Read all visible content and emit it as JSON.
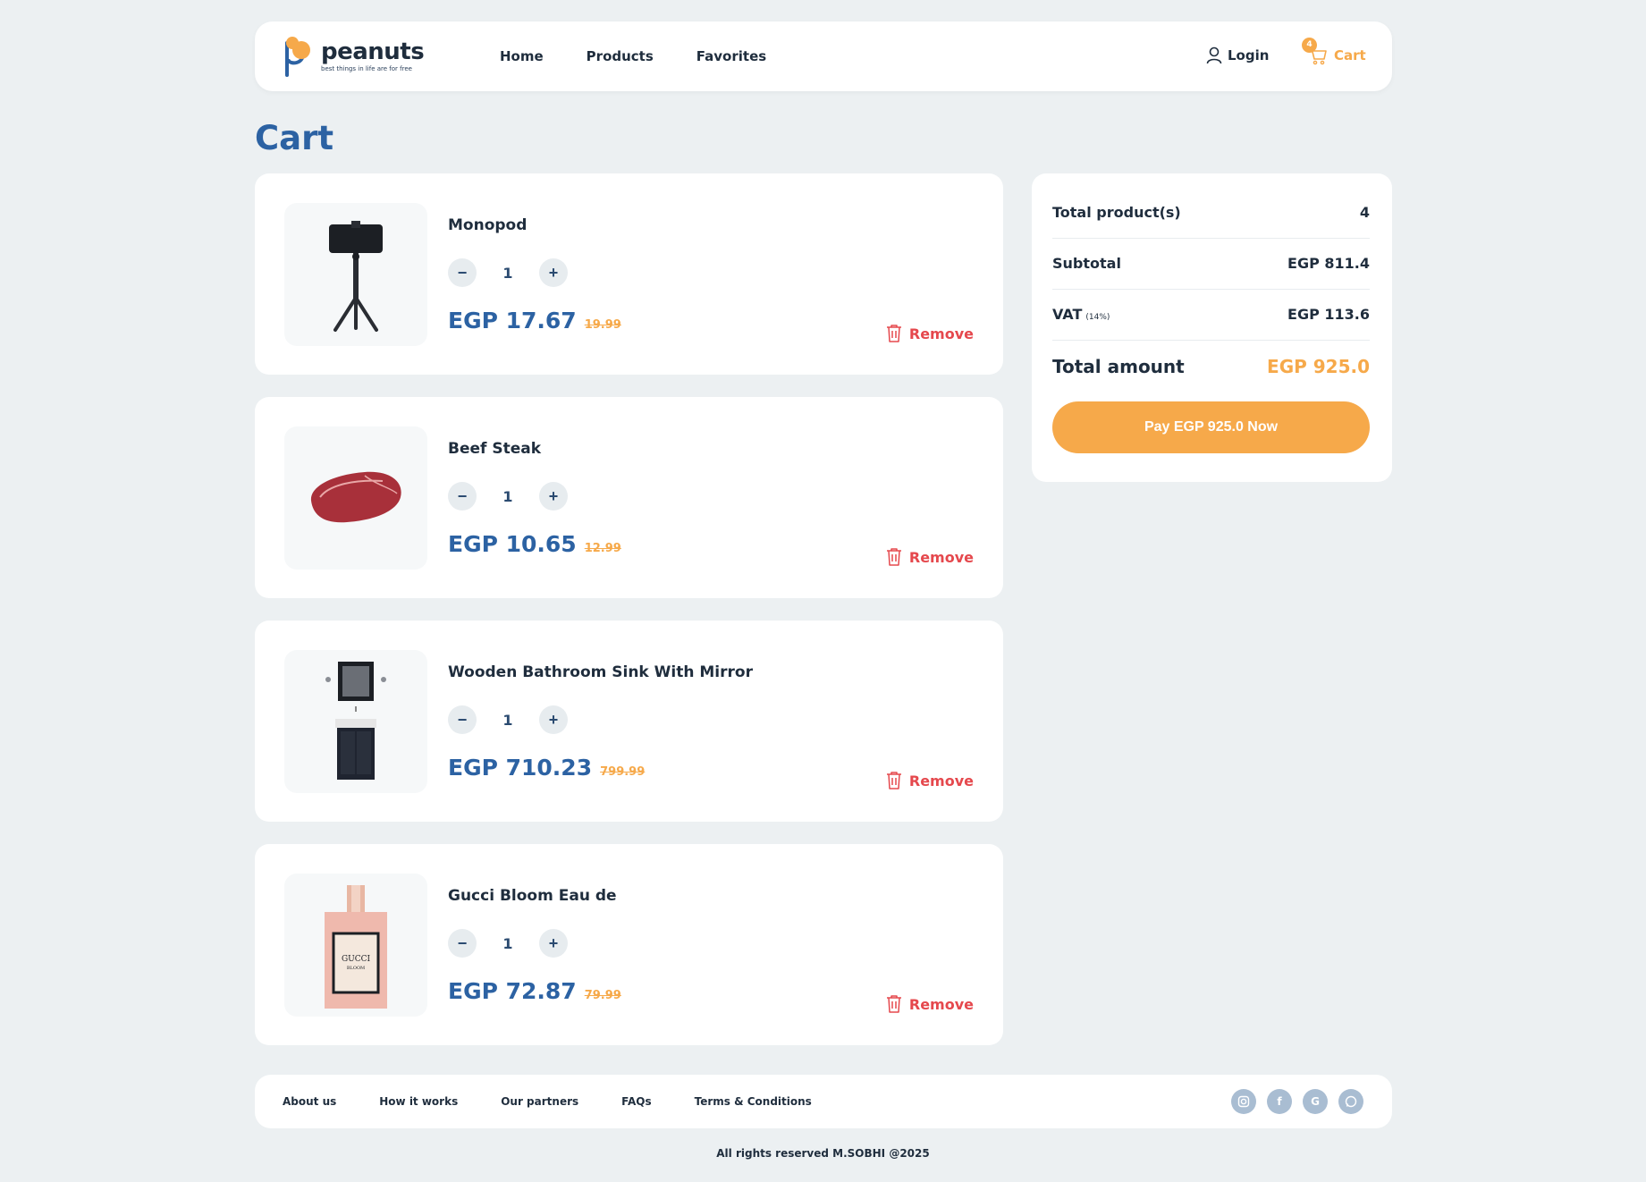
{
  "brand": {
    "name": "peanuts",
    "tagline": "best things in life are for free"
  },
  "nav": {
    "home": "Home",
    "products": "Products",
    "favorites": "Favorites"
  },
  "header": {
    "login": "Login",
    "cart": "Cart",
    "cart_count": "4"
  },
  "page_title": "Cart",
  "items": [
    {
      "name": "Monopod",
      "qty": "1",
      "price": "EGP 17.67",
      "old_price": "19.99",
      "remove": "Remove",
      "image": "monopod-image"
    },
    {
      "name": "Beef Steak",
      "qty": "1",
      "price": "EGP 10.65",
      "old_price": "12.99",
      "remove": "Remove",
      "image": "beef-steak-image"
    },
    {
      "name": "Wooden Bathroom Sink With Mirror",
      "qty": "1",
      "price": "EGP 710.23",
      "old_price": "799.99",
      "remove": "Remove",
      "image": "bathroom-sink-image"
    },
    {
      "name": "Gucci Bloom Eau de",
      "qty": "1",
      "price": "EGP 72.87",
      "old_price": "79.99",
      "remove": "Remove",
      "image": "gucci-bloom-image"
    }
  ],
  "summary": {
    "total_products_label": "Total product(s)",
    "total_products": "4",
    "subtotal_label": "Subtotal",
    "subtotal": "EGP 811.4",
    "vat_label": "VAT",
    "vat_rate": "(14%)",
    "vat": "EGP 113.6",
    "total_label": "Total amount",
    "total": "EGP 925.0",
    "pay_label": "Pay EGP 925.0 Now"
  },
  "footer": {
    "links": [
      "About us",
      "How it works",
      "Our partners",
      "FAQs",
      "Terms & Conditions"
    ],
    "social": [
      "instagram-icon",
      "facebook-icon",
      "google-icon",
      "whatsapp-icon"
    ],
    "copyright": "All rights reserved M.SOBHI @2025"
  },
  "colors": {
    "primary": "#2c62a3",
    "accent": "#f6a94a",
    "danger": "#e5484d",
    "background": "#ecf0f2"
  }
}
